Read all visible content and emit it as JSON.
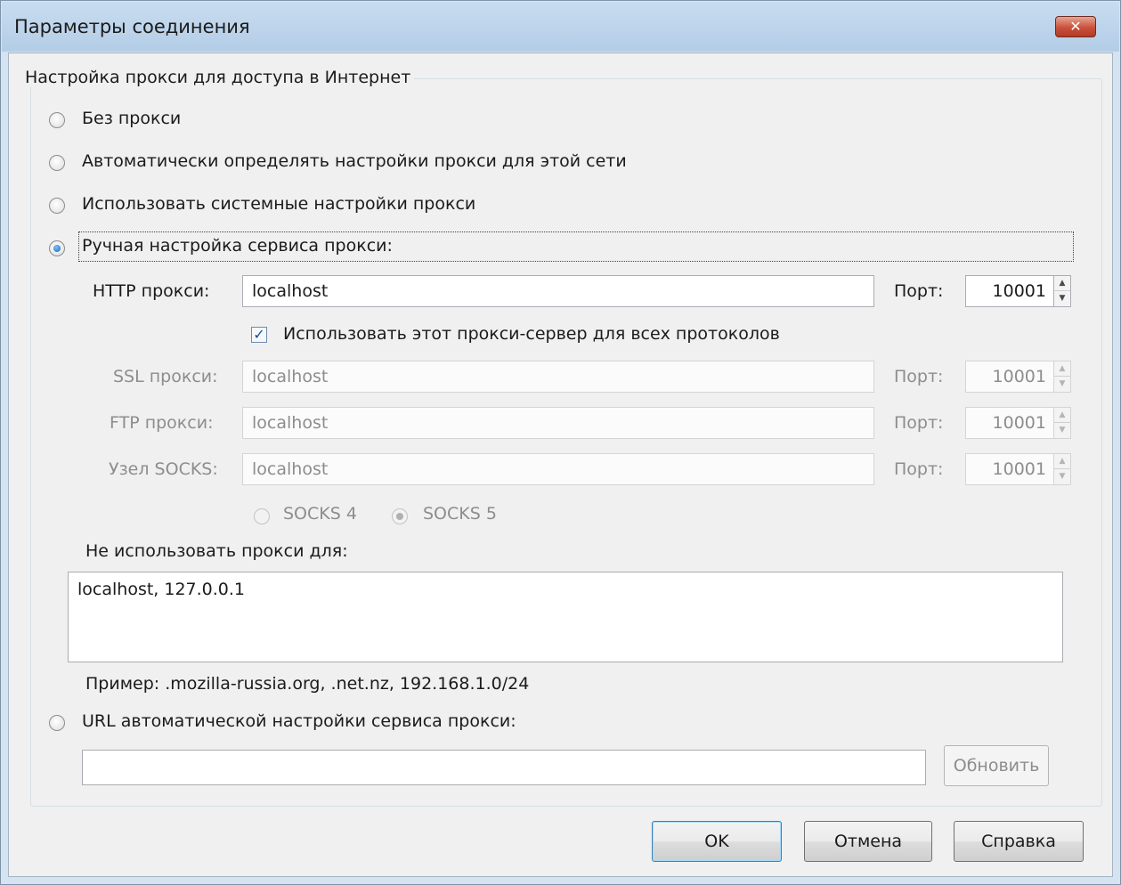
{
  "window": {
    "title": "Параметры соединения",
    "close_label": "✕"
  },
  "group": {
    "legend": "Настройка прокси для доступа в Интернет"
  },
  "proxy_modes": [
    {
      "label": "Без прокси",
      "selected": false
    },
    {
      "label": "Автоматически определять настройки прокси для этой сети",
      "selected": false
    },
    {
      "label": "Использовать системные настройки прокси",
      "selected": false
    },
    {
      "label": "Ручная настройка сервиса прокси:",
      "selected": true
    }
  ],
  "manual": {
    "http": {
      "label": "HTTP прокси:",
      "value": "localhost",
      "port_label": "Порт:",
      "port": "10001"
    },
    "use_for_all": {
      "label": "Использовать этот прокси-сервер для всех протоколов",
      "checked": true
    },
    "ssl": {
      "label": "SSL прокси:",
      "value": "localhost",
      "port_label": "Порт:",
      "port": "10001"
    },
    "ftp": {
      "label": "FTP прокси:",
      "value": "localhost",
      "port_label": "Порт:",
      "port": "10001"
    },
    "socks": {
      "label": "Узел SOCKS:",
      "value": "localhost",
      "port_label": "Порт:",
      "port": "10001"
    },
    "socks4": {
      "label": "SOCKS 4",
      "selected": false
    },
    "socks5": {
      "label": "SOCKS 5",
      "selected": true
    }
  },
  "no_proxy": {
    "label": "Не использовать прокси для:",
    "value": "localhost, 127.0.0.1",
    "example": "Пример: .mozilla-russia.org, .net.nz, 192.168.1.0/24"
  },
  "auto_url": {
    "label": "URL автоматической настройки сервиса прокси:",
    "selected": false,
    "value": "",
    "reload_label": "Обновить"
  },
  "buttons": {
    "ok": "OK",
    "cancel": "Отмена",
    "help": "Справка"
  },
  "icons": {
    "spin_up": "▲",
    "spin_down": "▼",
    "check": "✓"
  },
  "colors": {
    "title_bar": "#c9dcf0",
    "close_button": "#c9513b",
    "dialog_bg": "#f0f0f0",
    "radio_selected": "#1a5fb4"
  }
}
